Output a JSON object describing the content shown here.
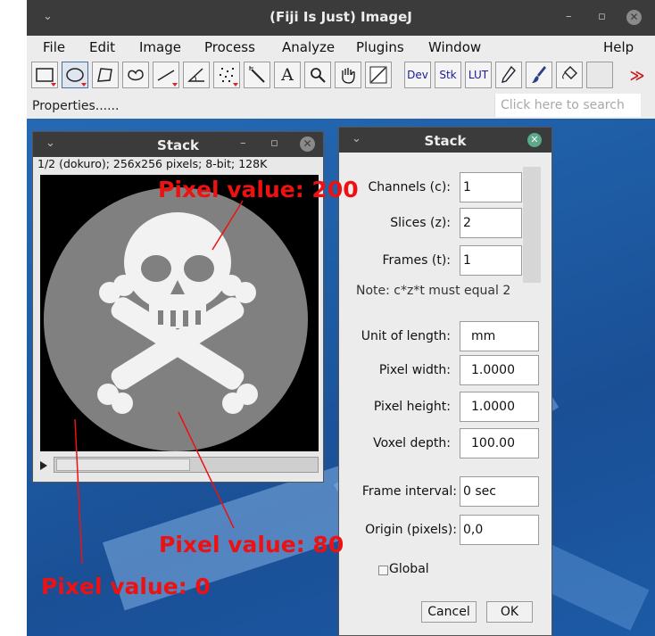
{
  "main_window": {
    "title": "(Fiji Is Just) ImageJ",
    "menus": [
      "File",
      "Edit",
      "Image",
      "Process",
      "Analyze",
      "Plugins",
      "Window",
      "Help"
    ],
    "tools": [
      {
        "icon": "rectangle-tool-icon"
      },
      {
        "icon": "oval-tool-icon"
      },
      {
        "icon": "polygon-tool-icon"
      },
      {
        "icon": "freehand-tool-icon"
      },
      {
        "icon": "line-tool-icon"
      },
      {
        "icon": "angle-tool-icon"
      },
      {
        "icon": "multipoint-tool-icon"
      },
      {
        "icon": "wand-tool-icon"
      },
      {
        "icon": "text-tool-icon",
        "label": "A"
      },
      {
        "icon": "magnifier-tool-icon"
      },
      {
        "icon": "hand-tool-icon"
      },
      {
        "icon": "color-picker-tool-icon"
      },
      {
        "icon": "dev-menu-icon",
        "label": "Dev"
      },
      {
        "icon": "stk-menu-icon",
        "label": "Stk"
      },
      {
        "icon": "lut-menu-icon",
        "label": "LUT"
      },
      {
        "icon": "pencil-tool-icon"
      },
      {
        "icon": "brush-tool-icon"
      },
      {
        "icon": "flood-fill-tool-icon"
      },
      {
        "icon": "more-tools-icon",
        "label": "≫"
      }
    ],
    "status": "Properties......",
    "search_placeholder": "Click here to search"
  },
  "stack_window": {
    "title": "Stack",
    "info": "1/2 (dokuro); 256x256 pixels; 8-bit; 128K",
    "image_description": "skull-and-crossbones",
    "image_colors": {
      "background": "#000000",
      "circle": "#808080",
      "skull": "#f2f2f2"
    }
  },
  "dialog": {
    "title": "Stack",
    "fields": {
      "channels": {
        "label": "Channels (c):",
        "value": "1"
      },
      "slices": {
        "label": "Slices (z):",
        "value": "2"
      },
      "frames": {
        "label": "Frames (t):",
        "value": "1"
      },
      "unit": {
        "label": "Unit of length:",
        "value": "mm"
      },
      "pixel_width": {
        "label": "Pixel width:",
        "value": "1.0000"
      },
      "pixel_height": {
        "label": "Pixel height:",
        "value": "1.0000"
      },
      "voxel_depth": {
        "label": "Voxel depth:",
        "value": "100.00"
      },
      "frame_interval": {
        "label": "Frame interval:",
        "value": "0 sec"
      },
      "origin": {
        "label": "Origin (pixels):",
        "value": "0,0"
      }
    },
    "note": "Note: c*z*t must equal 2",
    "global_label": "Global",
    "cancel_label": "Cancel",
    "ok_label": "OK"
  },
  "annotations": {
    "skull": "Pixel value: 200",
    "circle": "Pixel value: 80",
    "background": "Pixel value: 0",
    "color": "#ee1111"
  }
}
